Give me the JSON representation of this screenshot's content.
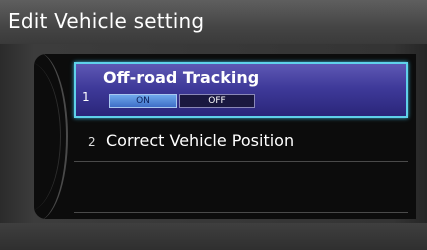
{
  "header": {
    "title": "Edit Vehicle setting"
  },
  "menu": {
    "items": [
      {
        "number": "1",
        "label": "Off-road Tracking",
        "options": [
          "ON",
          "OFF"
        ],
        "selected": "ON"
      },
      {
        "number": "2",
        "label": "Correct Vehicle Position"
      }
    ]
  },
  "colors": {
    "highlight": "#3f3a9a",
    "highlight_border": "#5fd1ea",
    "selected_option": "#4f86d8"
  }
}
